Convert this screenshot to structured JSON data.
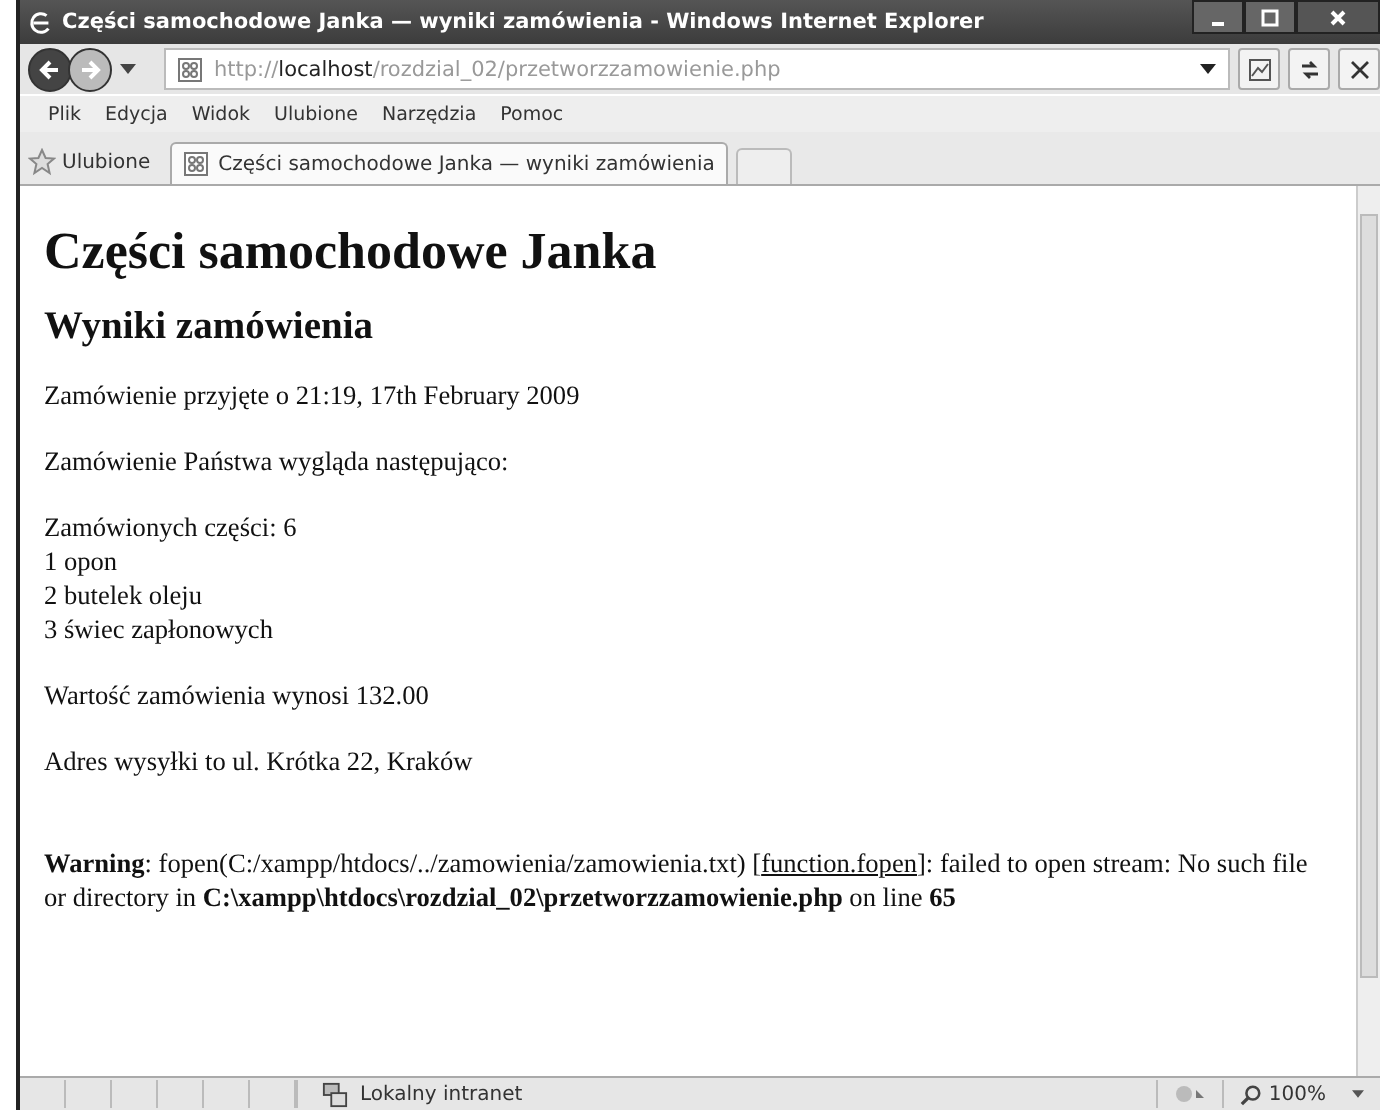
{
  "window": {
    "title": "Części samochodowe Janka — wyniki zamówienia - Windows Internet Explorer"
  },
  "address_bar": {
    "scheme": "http://",
    "host": "localhost",
    "path": "/rozdzial_02/przetworzzamowienie.php"
  },
  "menu": [
    "Plik",
    "Edycja",
    "Widok",
    "Ulubione",
    "Narzędzia",
    "Pomoc"
  ],
  "favorites": {
    "label": "Ulubione"
  },
  "tabs": [
    {
      "label": "Części samochodowe Janka — wyniki zamówienia",
      "selected": true
    }
  ],
  "page": {
    "heading": "Części samochodowe Janka",
    "subheading": "Wyniki zamówienia",
    "blocks": [
      [
        "Zamówienie przyjęte o 21:19, 17th February 2009"
      ],
      [
        "Zamówienie Państwa wygląda następująco:"
      ],
      [
        "Zamówionych części: 6",
        "1 opon",
        "2 butelek oleju",
        "3 świec zapłonowych"
      ],
      [
        "Wartość zamówienia wynosi 132.00"
      ],
      [
        "Adres wysyłki to ul. Krótka 22, Kraków"
      ]
    ],
    "warning": {
      "before": "**Warning**: fopen(C:/xampp/htdocs/../zamowienia/zamowienia.txt) [",
      "link": "function.fopen",
      "after": "]: failed to open stream: No such file or directory in **C:\\xampp\\htdocs\\rozdzial_02\\przetworzzamowienie.php** on line **65**"
    }
  },
  "status_bar": {
    "zone": "Lokalny intranet",
    "zoom": "100%"
  }
}
